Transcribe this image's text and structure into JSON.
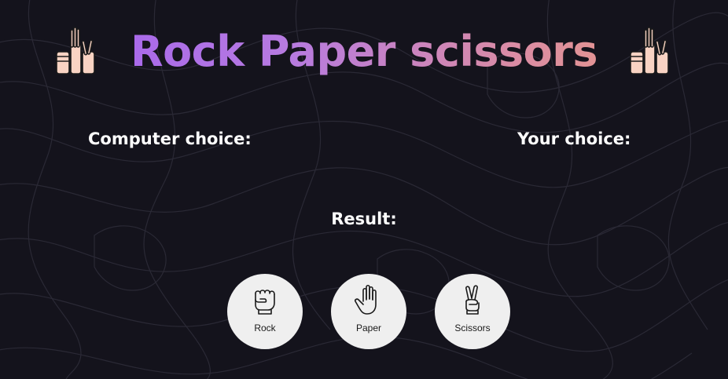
{
  "header": {
    "title": "Rock Paper scissors",
    "left_icon": "raised-hands-emoji-icon",
    "right_icon": "raised-hands-emoji-icon"
  },
  "computer_choice": {
    "label": "Computer choice:",
    "value": ""
  },
  "your_choice": {
    "label": "Your choice:",
    "value": ""
  },
  "result": {
    "label": "Result:",
    "value": ""
  },
  "choices": [
    {
      "label": "Rock",
      "icon": "fist-icon"
    },
    {
      "label": "Paper",
      "icon": "open-hand-icon"
    },
    {
      "label": "Scissors",
      "icon": "peace-hand-icon"
    }
  ],
  "colors": {
    "background": "#14131c",
    "title_gradient_start": "#9e5cf2",
    "title_gradient_end": "#f0a07d",
    "button_bg": "#efefef",
    "emoji_skin": "#f9d3c3"
  }
}
